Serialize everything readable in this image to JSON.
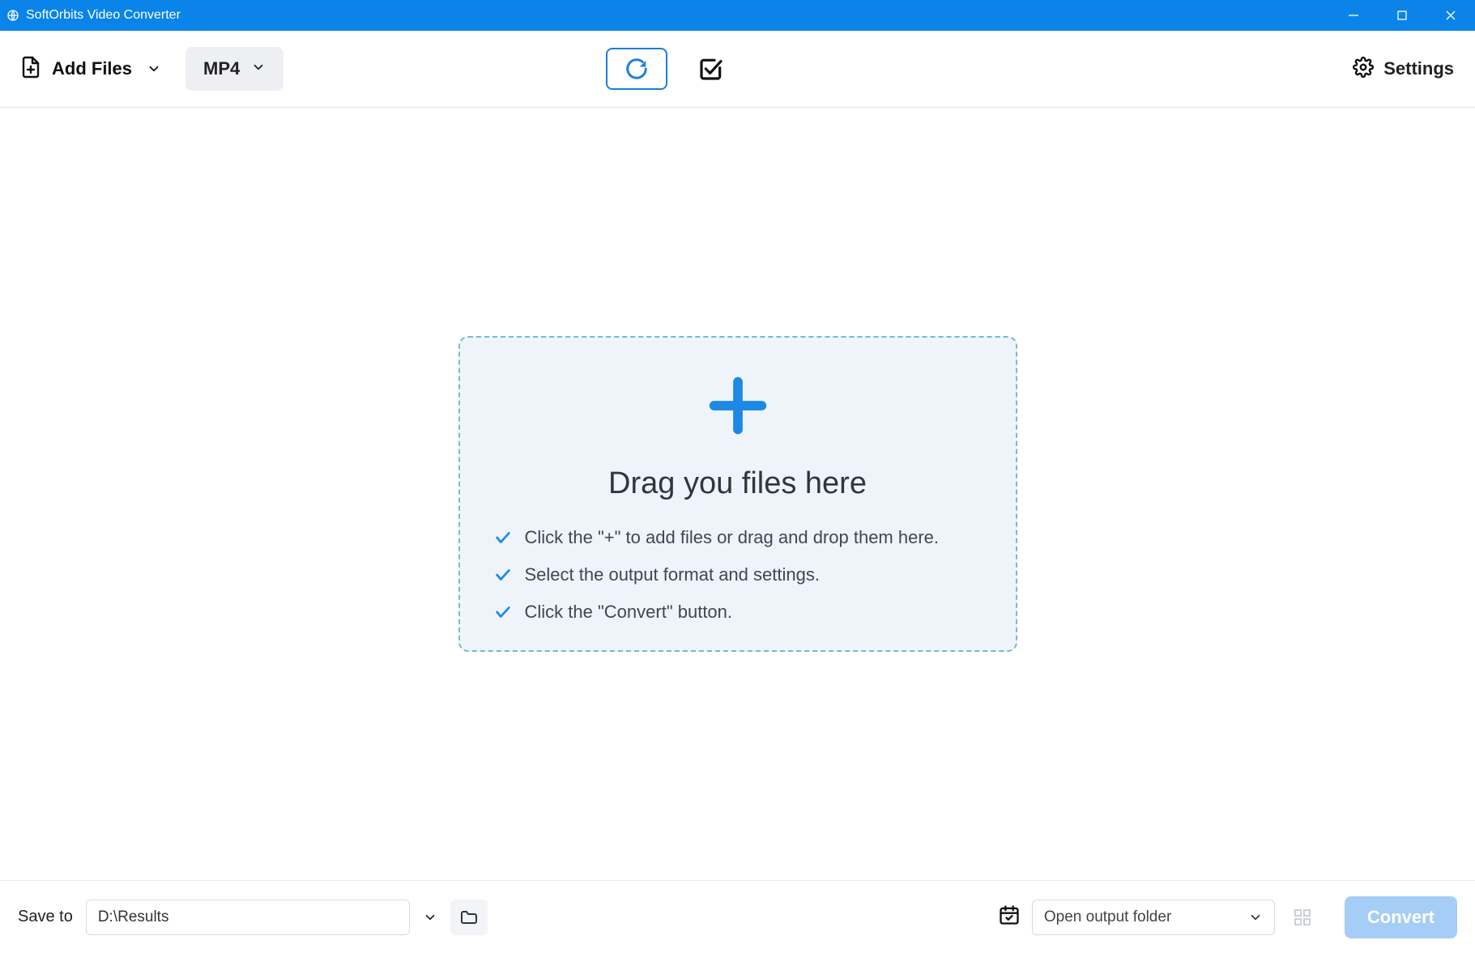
{
  "titlebar": {
    "app_name": "SoftOrbits Video Converter"
  },
  "toolbar": {
    "add_files_label": "Add Files",
    "format_selected": "MP4",
    "settings_label": "Settings"
  },
  "dropzone": {
    "title": "Drag you files here",
    "steps": [
      "Click the \"+\" to add files or drag and drop them here.",
      "Select the output format and settings.",
      "Click the \"Convert\" button."
    ]
  },
  "bottombar": {
    "saveto_label": "Save to",
    "saveto_path": "D:\\Results",
    "open_folder_label": "Open output folder",
    "convert_label": "Convert"
  }
}
